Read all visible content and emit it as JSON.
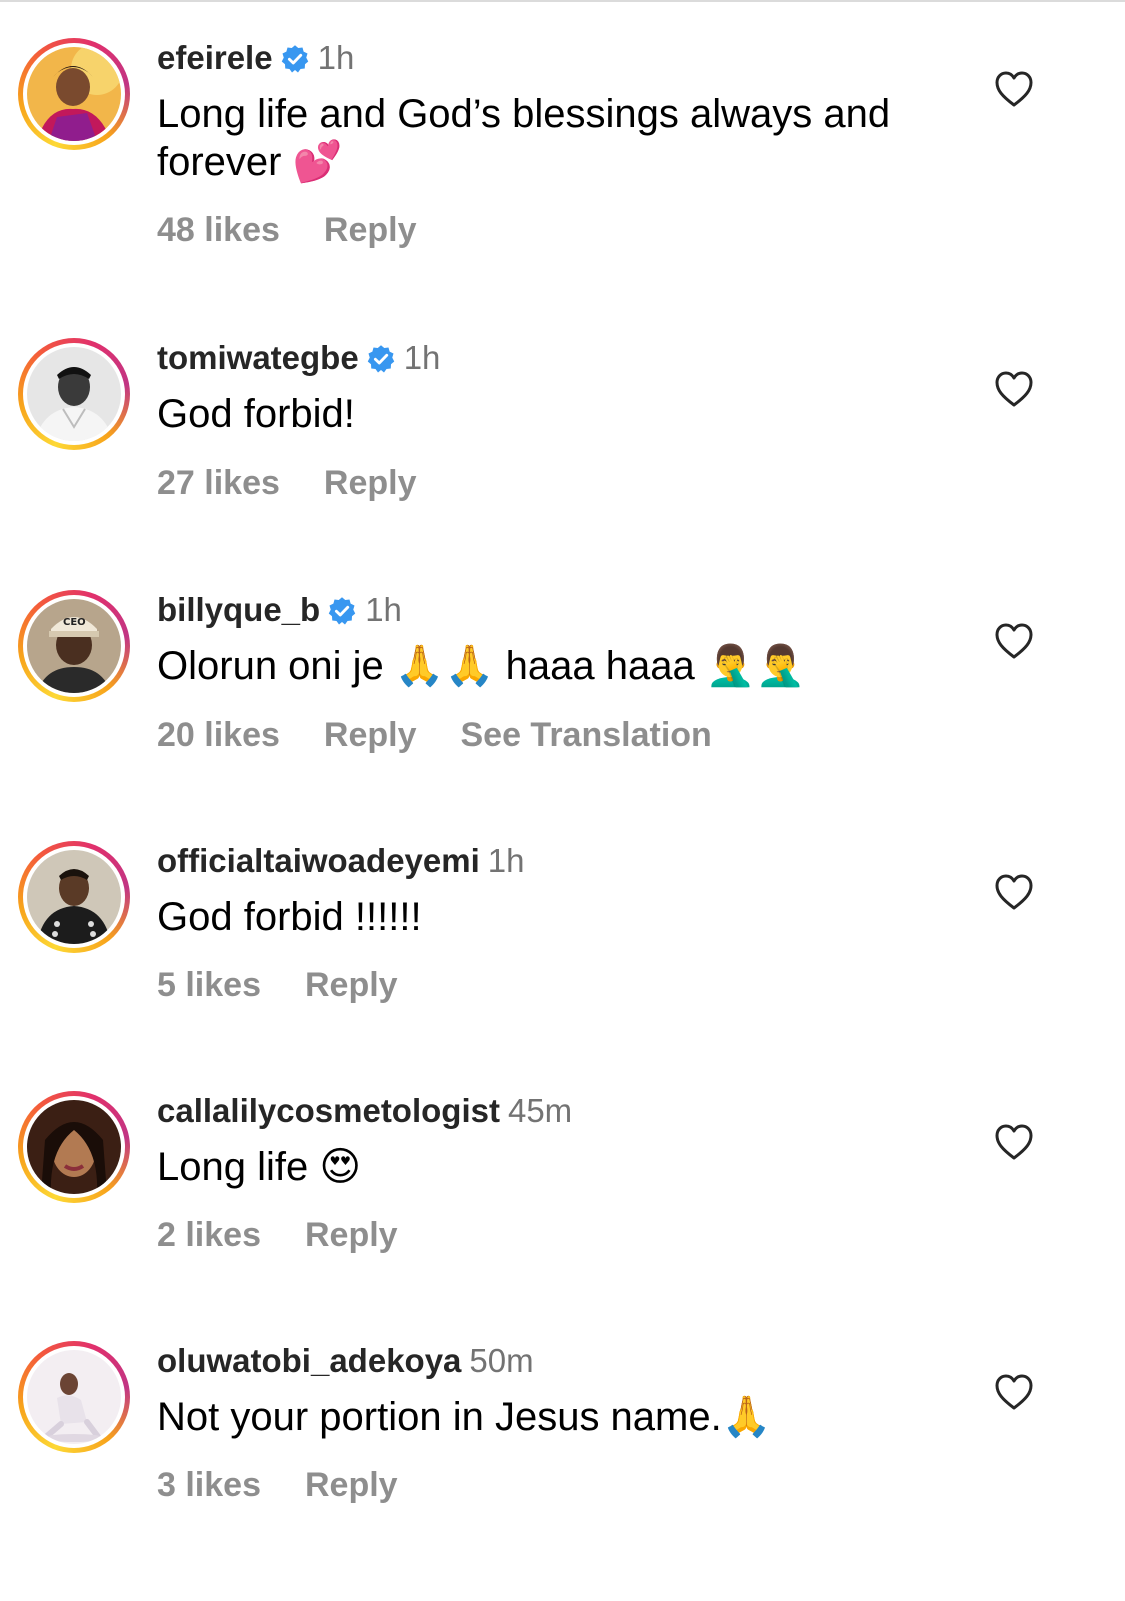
{
  "comments": [
    {
      "username": "efeirele",
      "verified": true,
      "time": "1h",
      "text": "Long life and God’s blessings always and forever",
      "emoji": "💕",
      "likes": "48 likes",
      "reply": "Reply"
    },
    {
      "username": "tomiwategbe",
      "verified": true,
      "time": "1h",
      "text": "God forbid!",
      "emoji": "",
      "likes": "27 likes",
      "reply": "Reply"
    },
    {
      "username": "billyque_b",
      "verified": true,
      "time": "1h",
      "text": "Olorun oni je",
      "emoji": "🙏🙏",
      "text2": "haaa haaa",
      "emoji2": "🤦‍♂️🤦‍♂️",
      "likes": "20 likes",
      "reply": "Reply",
      "translate": "See Translation"
    },
    {
      "username": "officialtaiwoadeyemi",
      "verified": false,
      "time": "1h",
      "text": "God forbid !!!!!!",
      "emoji": "",
      "likes": "5 likes",
      "reply": "Reply"
    },
    {
      "username": "callalilycosmetologist",
      "verified": false,
      "time": "45m",
      "text": "Long life",
      "emoji": "😍",
      "likes": "2 likes",
      "reply": "Reply"
    },
    {
      "username": "oluwatobi_adekoya",
      "verified": false,
      "time": "50m",
      "text": "Not your portion in Jesus name.",
      "emoji": "🙏",
      "likes": "3 likes",
      "reply": "Reply"
    }
  ],
  "colors": {
    "verified_badge": "#3897f0",
    "secondary_text": "#8e8e8e",
    "username": "#262626"
  },
  "icons": {
    "like": "heart-outline-icon",
    "verified": "verified-badge-icon"
  }
}
